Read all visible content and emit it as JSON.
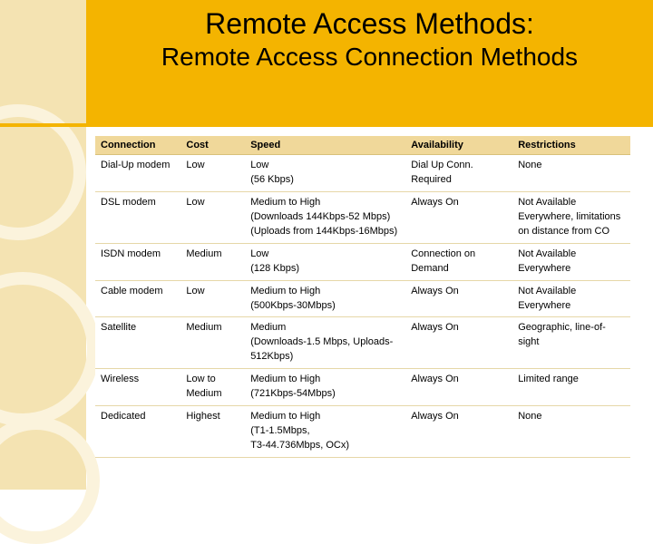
{
  "header": {
    "title": "Remote Access Methods:",
    "subtitle": "Remote Access Connection Methods"
  },
  "table": {
    "headers": {
      "connection": "Connection",
      "cost": "Cost",
      "speed": "Speed",
      "availability": "Availability",
      "restrictions": "Restrictions"
    },
    "rows": [
      {
        "connection": "Dial-Up modem",
        "cost": "Low",
        "speed": "Low\n(56 Kbps)",
        "availability": "Dial Up Conn. Required",
        "restrictions": "None"
      },
      {
        "connection": "DSL modem",
        "cost": "Low",
        "speed": "Medium to High\n(Downloads 144Kbps-52 Mbps)\n(Uploads from 144Kbps-16Mbps)",
        "availability": "Always On",
        "restrictions": "Not Available Everywhere, limitations on distance from CO"
      },
      {
        "connection": "ISDN modem",
        "cost": "Medium",
        "speed": "Low\n(128 Kbps)",
        "availability": "Connection on Demand",
        "restrictions": "Not Available Everywhere"
      },
      {
        "connection": "Cable modem",
        "cost": "Low",
        "speed": "Medium to High\n(500Kbps-30Mbps)",
        "availability": "Always On",
        "restrictions": "Not Available Everywhere"
      },
      {
        "connection": "Satellite",
        "cost": "Medium",
        "speed": "Medium\n(Downloads-1.5 Mbps, Uploads-512Kbps)",
        "availability": "Always On",
        "restrictions": "Geographic, line-of-sight"
      },
      {
        "connection": "Wireless",
        "cost": "Low to Medium",
        "speed": "Medium to High\n(721Kbps-54Mbps)",
        "availability": "Always On",
        "restrictions": "Limited range"
      },
      {
        "connection": "Dedicated",
        "cost": "Highest",
        "speed": "Medium to High\n(T1-1.5Mbps,\nT3-44.736Mbps, OCx)",
        "availability": "Always On",
        "restrictions": "None"
      }
    ]
  }
}
